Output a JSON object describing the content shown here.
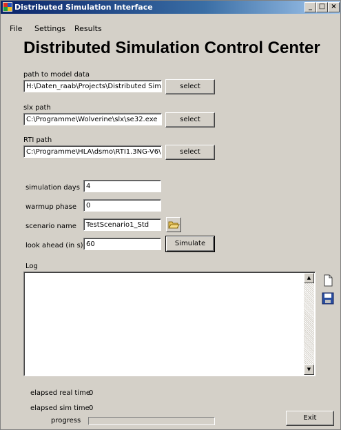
{
  "window": {
    "title": "Distributed Simulation Interface"
  },
  "menu": [
    "File",
    "Settings",
    "Results"
  ],
  "heading": "Distributed Simulation Control Center",
  "paths": [
    {
      "label": "path to model data",
      "value": "H:\\Daten_raab\\Projects\\Distributed Simula",
      "button": "select"
    },
    {
      "label": "slx path",
      "value": "C:\\Programme\\Wolverine\\slx\\se32.exe",
      "button": "select"
    },
    {
      "label": "RTI path",
      "value": "C:\\Programme\\HLA\\dsmo\\RTI1.3NG-V6\\",
      "button": "select"
    }
  ],
  "params": {
    "simulation_days": {
      "label": "simulation days",
      "value": "4"
    },
    "warmup_phase": {
      "label": "warmup phase",
      "value": "0"
    },
    "scenario_name": {
      "label": "scenario name",
      "value": "TestScenario1_Std"
    },
    "look_ahead": {
      "label": "look ahead (in s)",
      "value": "60"
    }
  },
  "simulate_label": "Simulate",
  "log": {
    "label": "Log",
    "content": ""
  },
  "status": {
    "elapsed_real_label": "elapsed real time",
    "elapsed_real_value": "0",
    "elapsed_sim_label": "elapsed sim time",
    "elapsed_sim_value": "0",
    "progress_label": "progress",
    "progress_fraction": 0
  },
  "exit_label": "Exit",
  "colors": {
    "titlebar_start": "#0a246a",
    "titlebar_end": "#a6caf0",
    "face": "#d4d0c8"
  },
  "icons": [
    "app-icon",
    "minimize-icon",
    "maximize-icon",
    "close-icon",
    "folder-open-icon",
    "new-document-icon",
    "save-icon",
    "scroll-up-icon",
    "scroll-down-icon"
  ]
}
